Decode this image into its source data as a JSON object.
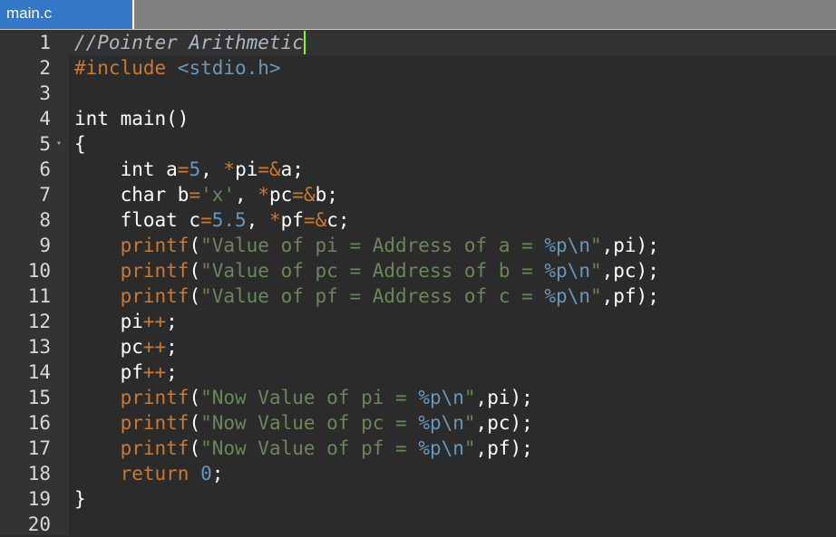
{
  "window": {
    "tab_title": "main.c"
  },
  "editor": {
    "lines": [
      {
        "n": "1",
        "tokens": [
          [
            "//Pointer Arithmetic",
            "comment"
          ]
        ],
        "caret": true
      },
      {
        "n": "2",
        "tokens": [
          [
            "#include ",
            "pre"
          ],
          [
            "<stdio.h>",
            "inc"
          ]
        ]
      },
      {
        "n": "3",
        "tokens": []
      },
      {
        "n": "4",
        "tokens": [
          [
            "int main()",
            "plain"
          ]
        ]
      },
      {
        "n": "5",
        "fold": true,
        "tokens": [
          [
            "{",
            "plain"
          ]
        ]
      },
      {
        "n": "6",
        "tokens": [
          [
            "    int a",
            "plain"
          ],
          [
            "=",
            "op"
          ],
          [
            "5",
            "num"
          ],
          [
            ", ",
            "plain"
          ],
          [
            "*",
            "op"
          ],
          [
            "pi",
            "plain"
          ],
          [
            "=&",
            "op"
          ],
          [
            "a;",
            "plain"
          ]
        ]
      },
      {
        "n": "7",
        "tokens": [
          [
            "    char b",
            "plain"
          ],
          [
            "=",
            "op"
          ],
          [
            "'x'",
            "str"
          ],
          [
            ", ",
            "plain"
          ],
          [
            "*",
            "op"
          ],
          [
            "pc",
            "plain"
          ],
          [
            "=&",
            "op"
          ],
          [
            "b;",
            "plain"
          ]
        ]
      },
      {
        "n": "8",
        "tokens": [
          [
            "    float c",
            "plain"
          ],
          [
            "=",
            "op"
          ],
          [
            "5.5",
            "num"
          ],
          [
            ", ",
            "plain"
          ],
          [
            "*",
            "op"
          ],
          [
            "pf",
            "plain"
          ],
          [
            "=&",
            "op"
          ],
          [
            "c;",
            "plain"
          ]
        ]
      },
      {
        "n": "9",
        "tokens": [
          [
            "    ",
            "plain"
          ],
          [
            "printf",
            "fn"
          ],
          [
            "(",
            "plain"
          ],
          [
            "\"Value of pi = Address of a = ",
            "str"
          ],
          [
            "%p\\n",
            "fmt"
          ],
          [
            "\"",
            "str"
          ],
          [
            ",pi);",
            "plain"
          ]
        ]
      },
      {
        "n": "10",
        "tokens": [
          [
            "    ",
            "plain"
          ],
          [
            "printf",
            "fn"
          ],
          [
            "(",
            "plain"
          ],
          [
            "\"Value of pc = Address of b = ",
            "str"
          ],
          [
            "%p\\n",
            "fmt"
          ],
          [
            "\"",
            "str"
          ],
          [
            ",pc);",
            "plain"
          ]
        ]
      },
      {
        "n": "11",
        "tokens": [
          [
            "    ",
            "plain"
          ],
          [
            "printf",
            "fn"
          ],
          [
            "(",
            "plain"
          ],
          [
            "\"Value of pf = Address of c = ",
            "str"
          ],
          [
            "%p\\n",
            "fmt"
          ],
          [
            "\"",
            "str"
          ],
          [
            ",pf);",
            "plain"
          ]
        ]
      },
      {
        "n": "12",
        "tokens": [
          [
            "    pi",
            "plain"
          ],
          [
            "++",
            "op"
          ],
          [
            ";",
            "plain"
          ]
        ]
      },
      {
        "n": "13",
        "tokens": [
          [
            "    pc",
            "plain"
          ],
          [
            "++",
            "op"
          ],
          [
            ";",
            "plain"
          ]
        ]
      },
      {
        "n": "14",
        "tokens": [
          [
            "    pf",
            "plain"
          ],
          [
            "++",
            "op"
          ],
          [
            ";",
            "plain"
          ]
        ]
      },
      {
        "n": "15",
        "tokens": [
          [
            "    ",
            "plain"
          ],
          [
            "printf",
            "fn"
          ],
          [
            "(",
            "plain"
          ],
          [
            "\"Now Value of pi = ",
            "str"
          ],
          [
            "%p\\n",
            "fmt"
          ],
          [
            "\"",
            "str"
          ],
          [
            ",pi);",
            "plain"
          ]
        ]
      },
      {
        "n": "16",
        "tokens": [
          [
            "    ",
            "plain"
          ],
          [
            "printf",
            "fn"
          ],
          [
            "(",
            "plain"
          ],
          [
            "\"Now Value of pc = ",
            "str"
          ],
          [
            "%p\\n",
            "fmt"
          ],
          [
            "\"",
            "str"
          ],
          [
            ",pc);",
            "plain"
          ]
        ]
      },
      {
        "n": "17",
        "tokens": [
          [
            "    ",
            "plain"
          ],
          [
            "printf",
            "fn"
          ],
          [
            "(",
            "plain"
          ],
          [
            "\"Now Value of pf = ",
            "str"
          ],
          [
            "%p\\n",
            "fmt"
          ],
          [
            "\"",
            "str"
          ],
          [
            ",pf);",
            "plain"
          ]
        ]
      },
      {
        "n": "18",
        "tokens": [
          [
            "    ",
            "plain"
          ],
          [
            "return",
            "kw"
          ],
          [
            " ",
            "plain"
          ],
          [
            "0",
            "num"
          ],
          [
            ";",
            "plain"
          ]
        ]
      },
      {
        "n": "19",
        "tokens": [
          [
            "}",
            "plain"
          ]
        ]
      },
      {
        "n": "20",
        "tokens": []
      }
    ]
  },
  "colors": {
    "tab_active": "#3477c9",
    "tabbar": "#808080",
    "editor_bg": "#2b2b2b",
    "keyword": "#cc7832",
    "string": "#6a8759",
    "number": "#6897bb",
    "caret": "#7cff00"
  }
}
